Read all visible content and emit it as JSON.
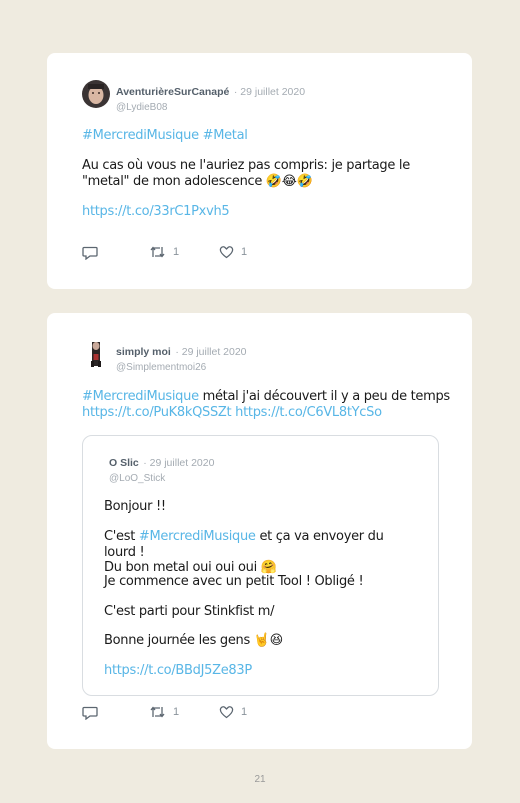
{
  "tweet1": {
    "author": "AventurièreSurCanapé",
    "date": "· 29 juillet 2020",
    "handle": "@LydieB08",
    "hashtags": "#MercrediMusique #Metal",
    "line1": "Au cas où vous ne l'auriez pas compris: je partage le",
    "line2": "\"metal\" de mon adolescence 🤣😂🤣",
    "link": "https://t.co/33rC1Pxvh5",
    "retweets": "1",
    "likes": "1"
  },
  "tweet2": {
    "author": "simply moi",
    "date": "· 29 juillet 2020",
    "handle": "@Simplementmoi26",
    "hashtag": "#MercrediMusique",
    "text_after_hashtag": " métal j'ai découvert il y a peu de temps",
    "link1": "https://t.co/PuK8kQSSZt",
    "link2": "https://t.co/C6VL8tYcSo",
    "retweets": "1",
    "likes": "1",
    "quote": {
      "author": "O Slic",
      "date": "· 29 juillet 2020",
      "handle": "@LoO_Stick",
      "p1": "Bonjour !!",
      "p2_before": "C'est ",
      "p2_hashtag": "#MercrediMusique",
      "p2_after": " et ça va envoyer du lourd !",
      "p2_line2": "Du bon metal oui oui oui 🤗",
      "p3": "Je commence avec un petit Tool ! Obligé !",
      "p4": "C'est parti pour Stinkfist m/",
      "p5": "Bonne journée les gens 🤘😆",
      "link": "https://t.co/BBdJ5Ze83P"
    }
  },
  "page_number": "21",
  "colors": {
    "background": "#efebe0",
    "link": "#58b6e6",
    "muted": "#a4abb2"
  },
  "icons": [
    "reply-icon",
    "retweet-icon",
    "like-icon"
  ]
}
